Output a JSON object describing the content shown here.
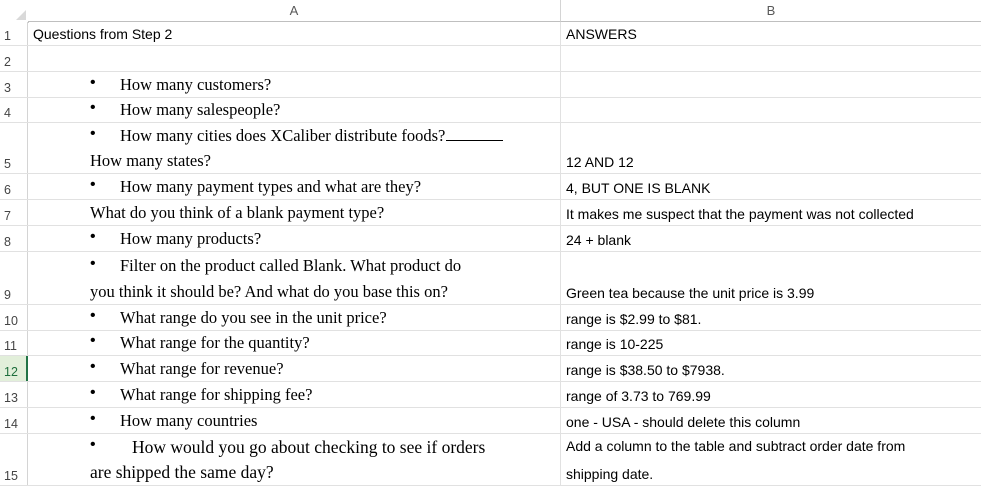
{
  "columns": {
    "a": "A",
    "b": "B"
  },
  "rows": {
    "r1": {
      "num": "1",
      "a": "Questions from Step 2",
      "b": "ANSWERS"
    },
    "r2": {
      "num": "2"
    },
    "r3": {
      "num": "3",
      "a_bullet": "How many customers?"
    },
    "r4": {
      "num": "4",
      "a_bullet": "How many salespeople?"
    },
    "r5": {
      "num": "5",
      "a_bullet": "How many cities does XCaliber distribute foods?",
      "a_line2": "How many states?",
      "b": "12 AND 12"
    },
    "r6": {
      "num": "6",
      "a_bullet": "How many payment types and what are they?",
      "b": "4, BUT ONE IS BLANK"
    },
    "r7": {
      "num": "7",
      "a": "What do you think of a blank payment type?",
      "b": "It makes me suspect that the payment was not collected"
    },
    "r8": {
      "num": "8",
      "a_bullet": "How many products?",
      "b": "24 + blank"
    },
    "r9": {
      "num": "9",
      "a_bullet": "Filter on the product called Blank.  What product do",
      "a_line2": "you think it should be?  And what do you base this on?",
      "b": "Green tea because the unit price is 3.99"
    },
    "r10": {
      "num": "10",
      "a_bullet": "What range do you see in the unit price?",
      "b": "range is $2.99 to $81."
    },
    "r11": {
      "num": "11",
      "a_bullet": "What range for the quantity?",
      "b": "range is 10-225"
    },
    "r12": {
      "num": "12",
      "a_bullet": "What range for revenue?",
      "b": "range is $38.50 to $7938."
    },
    "r13": {
      "num": "13",
      "a_bullet": "What range for shipping fee?",
      "b": "range of 3.73 to 769.99"
    },
    "r14": {
      "num": "14",
      "a_bullet": "How many countries",
      "b": "one - USA - should delete this column"
    },
    "r15": {
      "num": "15",
      "a_bullet": "How would you go about checking to see if orders",
      "a_line2": "are shipped the same day?",
      "b_line1": "Add a column to the table and subtract order date from",
      "b_line2": "shipping date."
    }
  },
  "selected_row": "12",
  "colors": {
    "selection": "#217346",
    "row_header_selected_bg": "#e2efda",
    "gridline": "#e1e1e1"
  }
}
